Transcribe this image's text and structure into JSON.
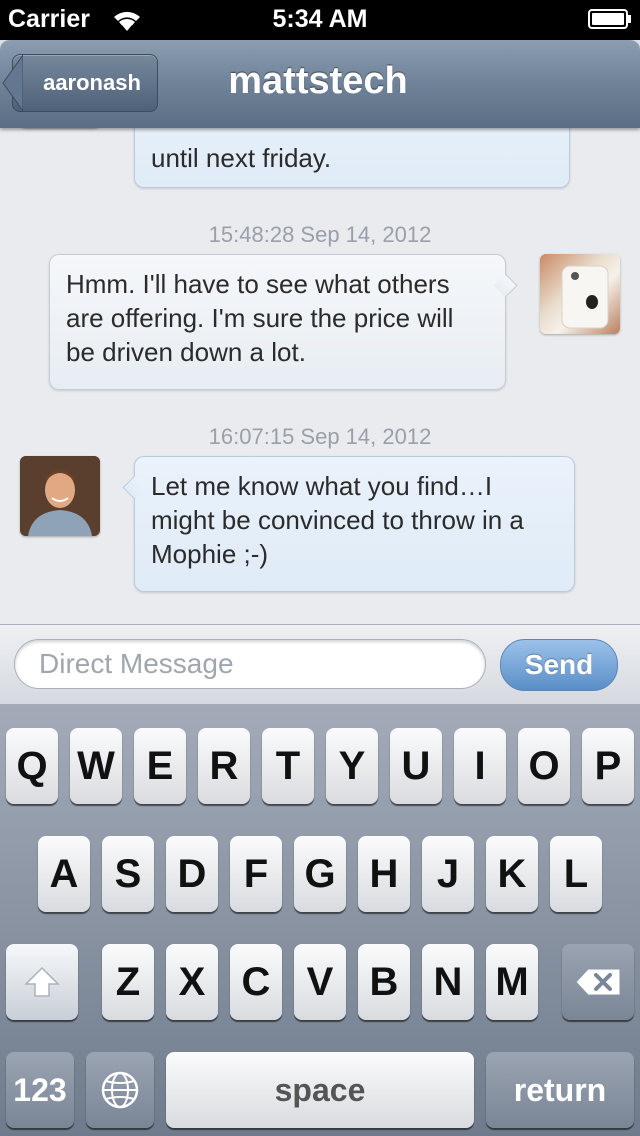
{
  "status_bar": {
    "carrier": "Carrier",
    "time": "5:34 AM"
  },
  "nav": {
    "back_label": "aaronash",
    "title": "mattstech"
  },
  "messages": [
    {
      "side": "incoming",
      "text": "until next friday.",
      "timestamp": ""
    },
    {
      "side": "outgoing",
      "text": "Hmm. I'll have to see what others are offering. I'm sure the price will be driven down a lot.",
      "timestamp": "15:48:28 Sep 14, 2012"
    },
    {
      "side": "incoming",
      "text": "Let me know what you find…I might be convinced to throw in a Mophie ;-)",
      "timestamp": "16:07:15 Sep 14, 2012"
    }
  ],
  "composer": {
    "placeholder": "Direct Message",
    "send_label": "Send"
  },
  "keyboard": {
    "row1": [
      "Q",
      "W",
      "E",
      "R",
      "T",
      "Y",
      "U",
      "I",
      "O",
      "P"
    ],
    "row2": [
      "A",
      "S",
      "D",
      "F",
      "G",
      "H",
      "J",
      "K",
      "L"
    ],
    "row3": [
      "Z",
      "X",
      "C",
      "V",
      "B",
      "N",
      "M"
    ],
    "numbers_label": "123",
    "space_label": "space",
    "return_label": "return"
  },
  "colors": {
    "nav_bar": "#6f8298",
    "send_button": "#5a8ec8",
    "incoming_bubble": "#e3eef9",
    "outgoing_bubble": "#f2f4f7"
  }
}
